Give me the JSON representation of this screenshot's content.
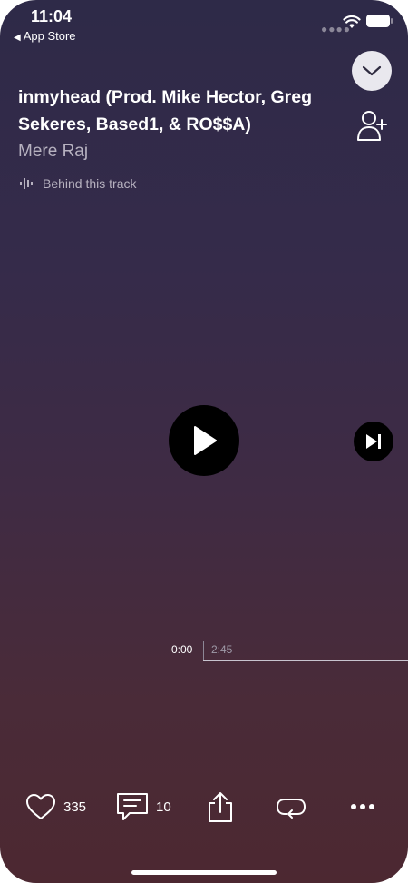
{
  "status_bar": {
    "time": "11:04",
    "back_label": "App Store",
    "back_arrow": "◀"
  },
  "track": {
    "title": "inmyhead (Prod. Mike Hector, Greg Sekeres, Based1, & RO$$A)",
    "artist": "Mere Raj",
    "behind_label": "Behind this track"
  },
  "player": {
    "current_time": "0:00",
    "duration": "2:45",
    "progress": 0
  },
  "actions": {
    "likes": "335",
    "comments": "10"
  },
  "icons": {
    "collapse": "chevron-down-icon",
    "follow": "add-user-icon",
    "behind": "waveform-icon",
    "play": "play-icon",
    "next": "skip-next-icon",
    "like": "heart-icon",
    "comment": "comment-icon",
    "share": "share-icon",
    "repost": "repost-icon",
    "more": "more-icon"
  },
  "colors": {
    "background_top": "#2e2a48",
    "background_bottom": "#4c2831",
    "secondary_text": "#b7b2c0"
  }
}
